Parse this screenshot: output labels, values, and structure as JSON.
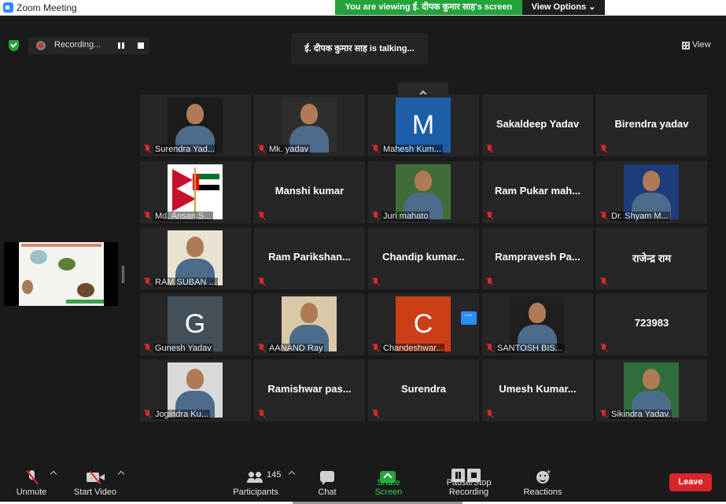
{
  "window": {
    "title": "Zoom Meeting"
  },
  "share_banner": "You are viewing ई. दीपक कुमार साह's screen",
  "view_options": "View Options ⌄",
  "recording": {
    "label": "Recording..."
  },
  "speaker": "ई. दीपक कुमार साह is talking...",
  "view_button": "View",
  "tiles": [
    {
      "label": "Surendra Yad...",
      "kind": "photo",
      "photo_color": "#1b1b1b"
    },
    {
      "label": "Mk. yadav",
      "kind": "photo",
      "photo_color": "#2e2e2e"
    },
    {
      "label": "Mahesh Kum...",
      "kind": "letter",
      "letter": "M",
      "bg": "#1c5fa8"
    },
    {
      "label": "",
      "kind": "name",
      "name": "Sakaldeep Yadav"
    },
    {
      "label": "",
      "kind": "name",
      "name": "Birendra yadav"
    },
    {
      "label": "Md. Ansari S...",
      "kind": "flags"
    },
    {
      "label": "",
      "kind": "name",
      "name": "Manshi kumar"
    },
    {
      "label": "Juri mahato",
      "kind": "photo",
      "photo_color": "#3f6d37"
    },
    {
      "label": "",
      "kind": "name",
      "name": "Ram Pukar mah..."
    },
    {
      "label": "Dr. Shyam M...",
      "kind": "photo",
      "photo_color": "#1d3c7a"
    },
    {
      "label": "RAM SUBAN ...",
      "kind": "photo",
      "photo_color": "#e8e2d0"
    },
    {
      "label": "",
      "kind": "name",
      "name": "Ram Parikshan..."
    },
    {
      "label": "",
      "kind": "name",
      "name": "Chandip kumar..."
    },
    {
      "label": "",
      "kind": "name",
      "name": "Rampravesh Pa..."
    },
    {
      "label": "",
      "kind": "name",
      "name": "राजेन्द्र राम"
    },
    {
      "label": "Gunesh Yadav",
      "kind": "letter",
      "letter": "G",
      "bg": "#43505a"
    },
    {
      "label": "AANAND Ray",
      "kind": "photo",
      "photo_color": "#d8c9a8"
    },
    {
      "label": "Chandeshwar...",
      "kind": "letter",
      "letter": "C",
      "bg": "#cc3e16"
    },
    {
      "label": "SANTOSH BIS...",
      "kind": "photo",
      "photo_color": "#1f1f1f"
    },
    {
      "label": "",
      "kind": "name",
      "name": "723983"
    },
    {
      "label": "Jogindra Ku...",
      "kind": "photo",
      "photo_color": "#d9d9d9"
    },
    {
      "label": "",
      "kind": "name",
      "name": "Ramishwar pas..."
    },
    {
      "label": "",
      "kind": "name",
      "name": "Surendra"
    },
    {
      "label": "",
      "kind": "name",
      "name": "Umesh Kumar..."
    },
    {
      "label": "Sikindra Yadav.",
      "kind": "photo",
      "photo_color": "#2f6e3c"
    }
  ],
  "more_badge": "···",
  "toolbar": {
    "unmute": "Unmute",
    "start_video": "Start Video",
    "participants": "Participants",
    "participants_count": "145",
    "chat": "Chat",
    "share_screen": "Share Screen",
    "record": "Pause/Stop Recording",
    "reactions": "Reactions",
    "leave": "Leave"
  }
}
